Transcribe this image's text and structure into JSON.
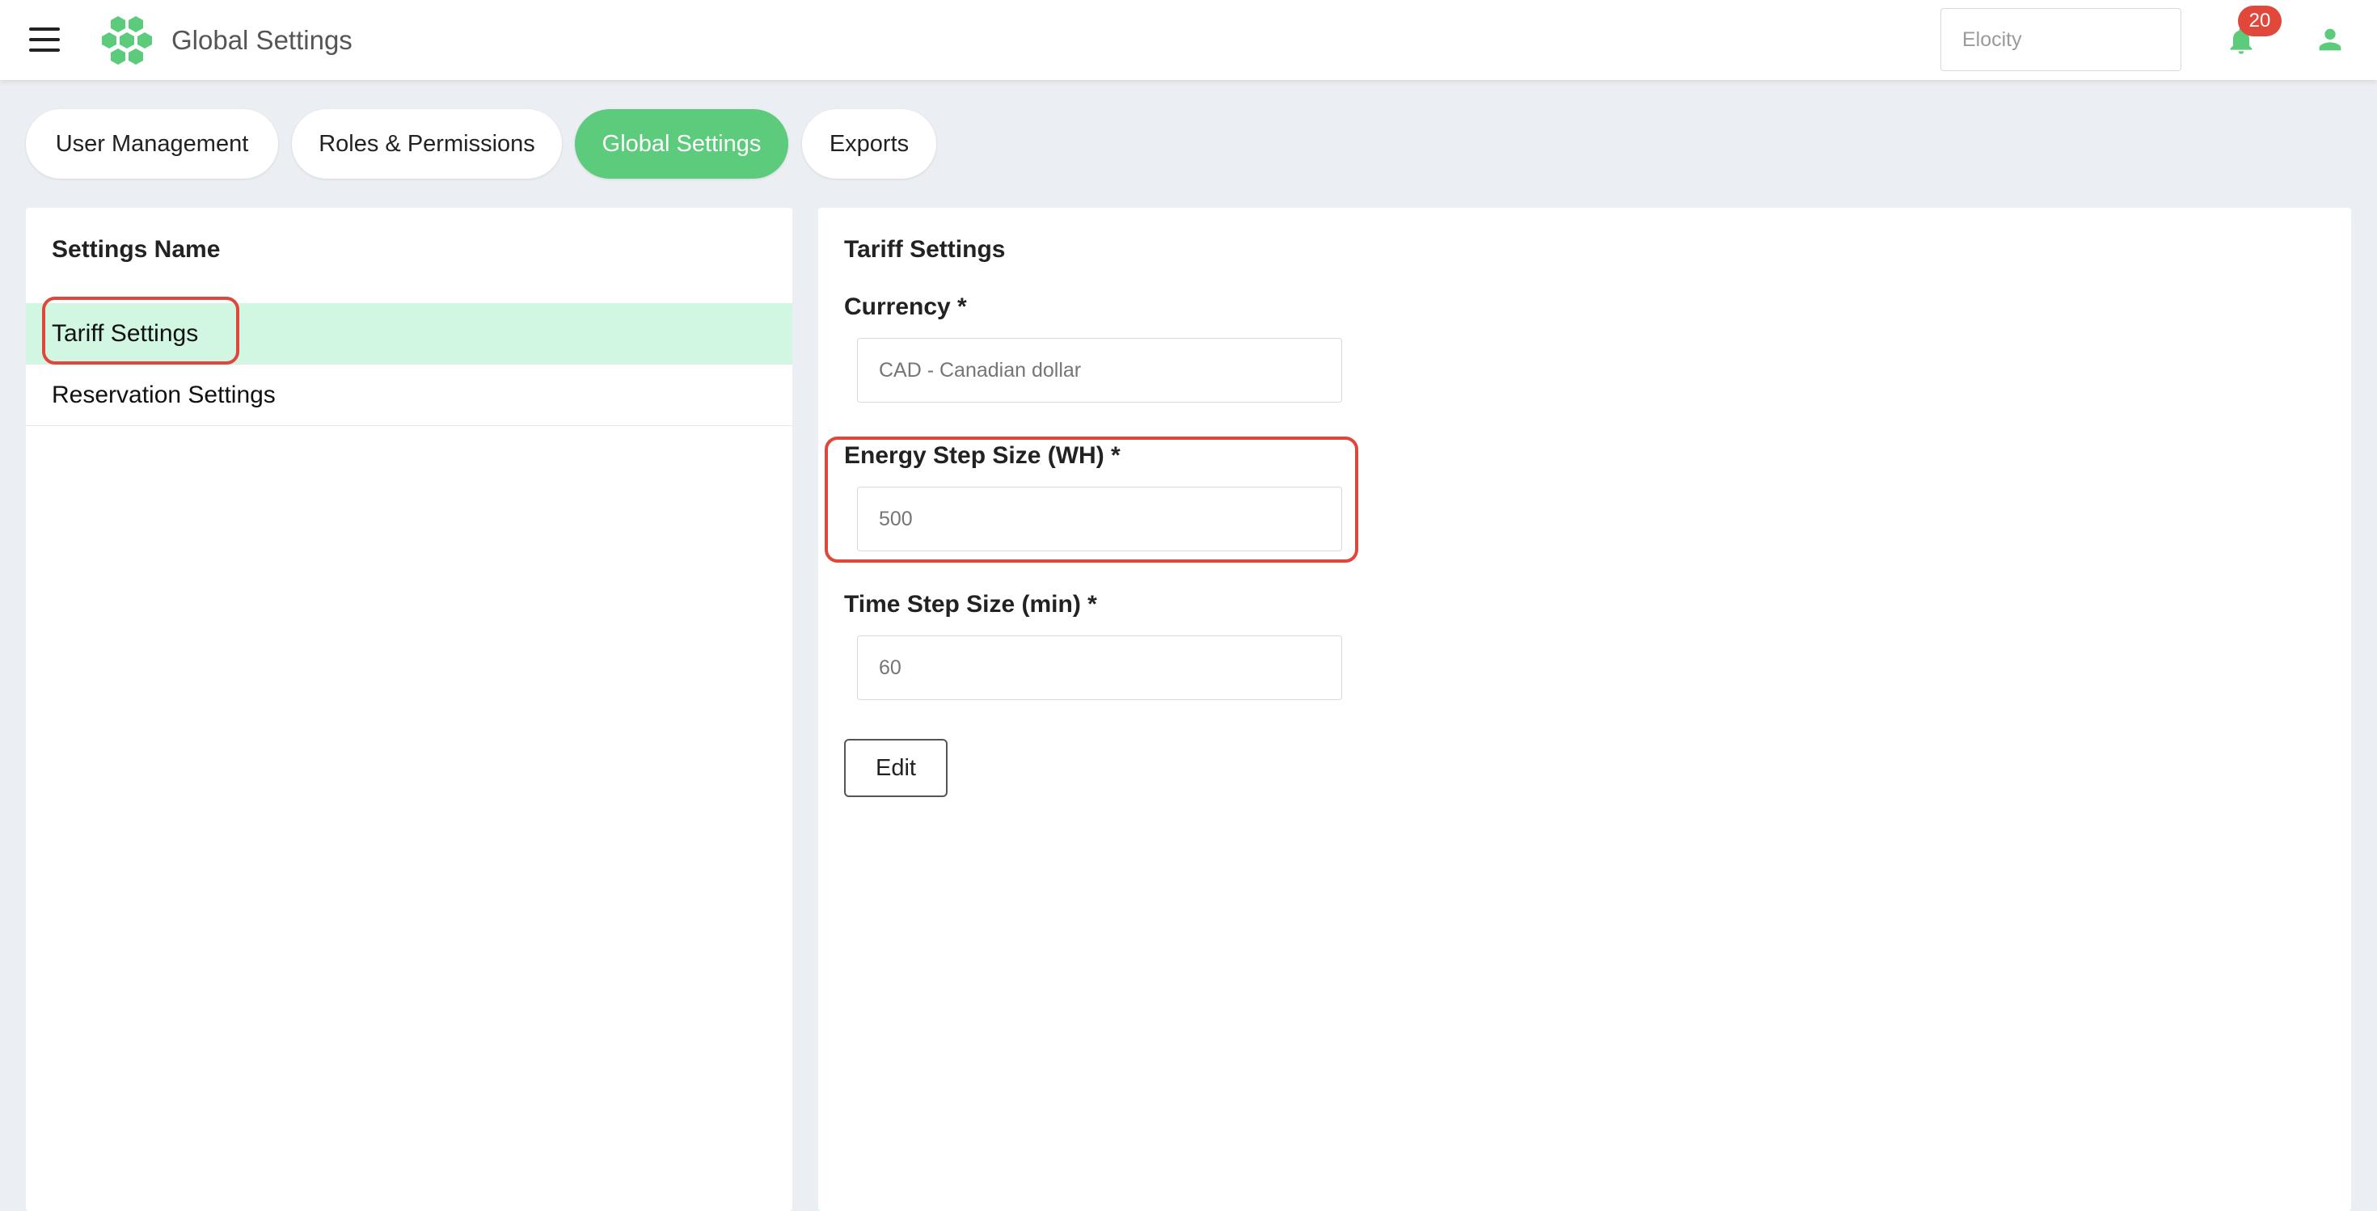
{
  "header": {
    "title": "Global Settings",
    "search": {
      "value": "",
      "placeholder": "Elocity"
    },
    "notifications_count": "20",
    "brand_color": "#5ccb7b"
  },
  "tabs": [
    {
      "label": "User Management",
      "active": false
    },
    {
      "label": "Roles & Permissions",
      "active": false
    },
    {
      "label": "Global Settings",
      "active": true
    },
    {
      "label": "Exports",
      "active": false
    }
  ],
  "settings_list": {
    "title": "Settings Name",
    "items": [
      {
        "label": "Tariff Settings",
        "selected": true
      },
      {
        "label": "Reservation Settings",
        "selected": false
      }
    ]
  },
  "form": {
    "title": "Tariff Settings",
    "fields": [
      {
        "label": "Currency *",
        "value": "",
        "placeholder": "CAD - Canadian dollar"
      },
      {
        "label": "Energy Step Size (WH) *",
        "value": "",
        "placeholder": "500"
      },
      {
        "label": "Time Step Size (min) *",
        "value": "",
        "placeholder": "60"
      }
    ],
    "edit_label": "Edit"
  },
  "colors": {
    "accent": "#5ccb7b",
    "selected_row": "#d1f7e3",
    "annotation": "#e0473a",
    "badge": "#e1473b",
    "background": "#ebeff4"
  },
  "icons": [
    "menu-icon",
    "hexagon-logo-icon",
    "bell-icon",
    "user-icon"
  ]
}
